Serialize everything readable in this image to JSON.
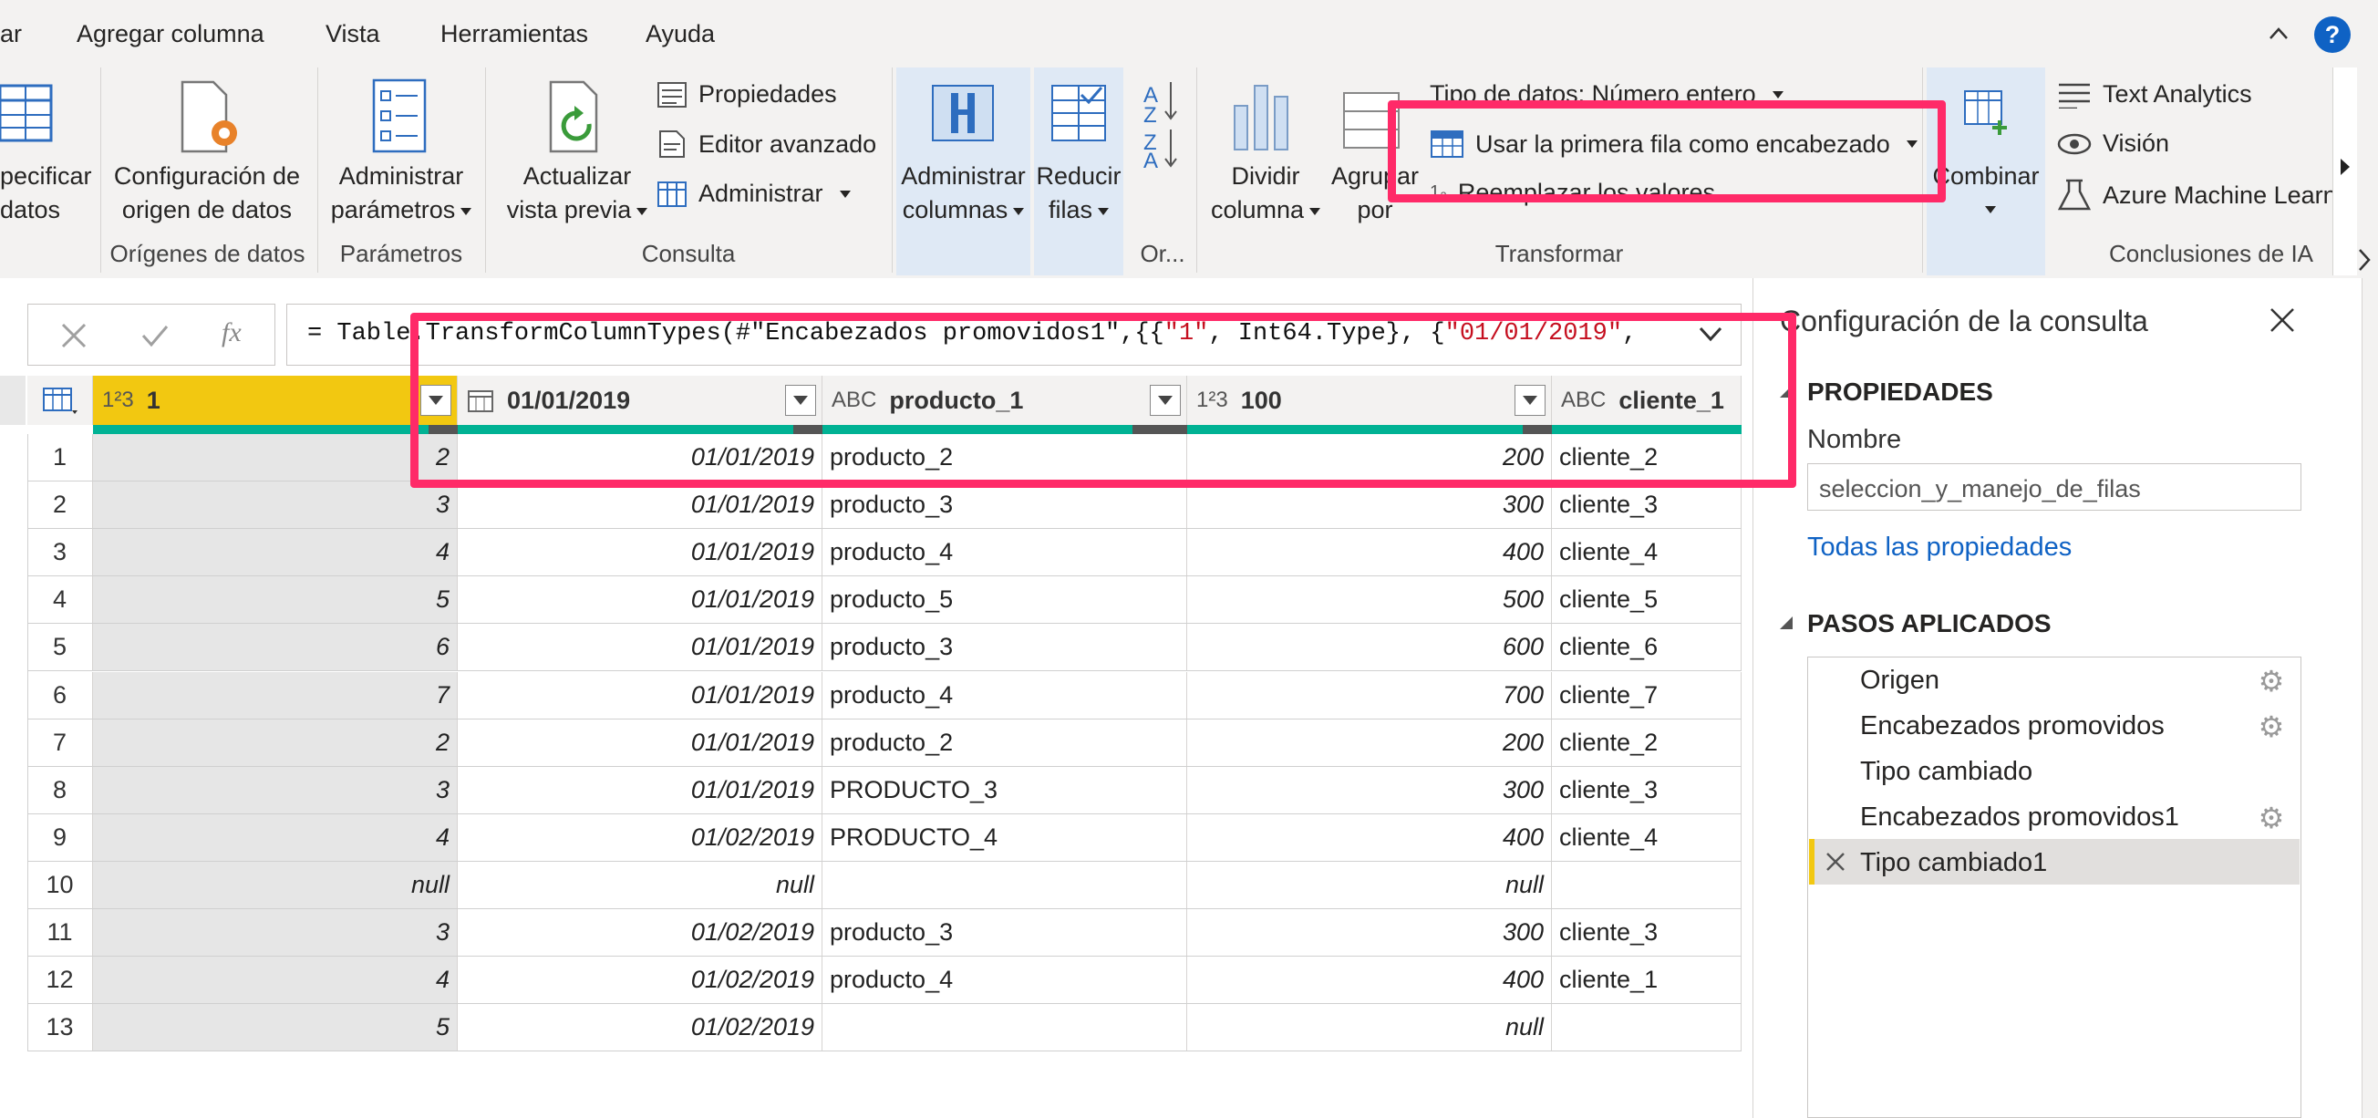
{
  "menu": [
    "ar",
    "Agregar columna",
    "Vista",
    "Herramientas",
    "Ayuda"
  ],
  "ribbon": {
    "origenes": {
      "btn1": [
        "pecificar",
        "datos"
      ],
      "btn2": [
        "Configuración de",
        "origen de datos"
      ],
      "label": "Orígenes de datos"
    },
    "parametros": {
      "btn": [
        "Administrar",
        "parámetros"
      ],
      "label": "Parámetros"
    },
    "consulta": {
      "actualizar": [
        "Actualizar",
        "vista previa"
      ],
      "propiedades": "Propiedades",
      "editor": "Editor avanzado",
      "administrar": "Administrar",
      "label": "Consulta"
    },
    "ordenar": {
      "adm_cols": [
        "Administrar",
        "columnas"
      ],
      "reducir": [
        "Reducir",
        "filas"
      ],
      "label": "Or..."
    },
    "transformar": {
      "dividir": [
        "Dividir",
        "columna"
      ],
      "agrupar": [
        "Agrupar",
        "por"
      ],
      "tipo_datos": "Tipo de datos: Número entero",
      "primera_fila": "Usar la primera fila como encabezado",
      "reemplazar": "Reemplazar los valores",
      "label": "Transformar"
    },
    "combinar": "Combinar",
    "ia": {
      "text_analytics": "Text Analytics",
      "vision": "Visión",
      "azure": "Azure Machine Learn",
      "label": "Conclusiones de IA"
    }
  },
  "formula": {
    "prefix": "= Table.TransformColumnTypes(#\"Encabezados promovidos1\",{{",
    "s1": "\"1\"",
    "mid": ", Int64.Type}, {",
    "s2": "\"01/01/2019\"",
    "suffix": ","
  },
  "columns": [
    {
      "type": "1²3",
      "name": "1"
    },
    {
      "type": "date-icon",
      "name": "01/01/2019"
    },
    {
      "type": "ABC",
      "name": "producto_1"
    },
    {
      "type": "1²3",
      "name": "100"
    },
    {
      "type": "ABC",
      "name": "cliente_1"
    }
  ],
  "rows": [
    [
      "1",
      "2",
      "01/01/2019",
      "producto_2",
      "200",
      "cliente_2"
    ],
    [
      "2",
      "3",
      "01/01/2019",
      "producto_3",
      "300",
      "cliente_3"
    ],
    [
      "3",
      "4",
      "01/01/2019",
      "producto_4",
      "400",
      "cliente_4"
    ],
    [
      "4",
      "5",
      "01/01/2019",
      "producto_5",
      "500",
      "cliente_5"
    ],
    [
      "5",
      "6",
      "01/01/2019",
      "producto_3",
      "600",
      "cliente_6"
    ],
    [
      "6",
      "7",
      "01/01/2019",
      "producto_4",
      "700",
      "cliente_7"
    ],
    [
      "7",
      "2",
      "01/01/2019",
      "producto_2",
      "200",
      "cliente_2"
    ],
    [
      "8",
      "3",
      "01/01/2019",
      "PRODUCTO_3",
      "300",
      "cliente_3"
    ],
    [
      "9",
      "4",
      "01/02/2019",
      "PRODUCTO_4",
      "400",
      "cliente_4"
    ],
    [
      "10",
      "null",
      "null",
      "",
      "null",
      ""
    ],
    [
      "11",
      "3",
      "01/02/2019",
      "producto_3",
      "300",
      "cliente_3"
    ],
    [
      "12",
      "4",
      "01/02/2019",
      "producto_4",
      "400",
      "cliente_1"
    ],
    [
      "13",
      "5",
      "01/02/2019",
      "",
      "null",
      ""
    ]
  ],
  "pane": {
    "title": "Configuración de la consulta",
    "propiedades": "PROPIEDADES",
    "nombre_label": "Nombre",
    "nombre_value": "seleccion_y_manejo_de_filas",
    "todas": "Todas las propiedades",
    "pasos": "PASOS APLICADOS",
    "steps": [
      "Origen",
      "Encabezados promovidos",
      "Tipo cambiado",
      "Encabezados promovidos1",
      "Tipo cambiado1"
    ]
  },
  "colors": {
    "highlight": "#ff2a68",
    "accent": "#0078d4",
    "selected_header": "#f2c811",
    "quality": "#00b294"
  },
  "help": "?"
}
